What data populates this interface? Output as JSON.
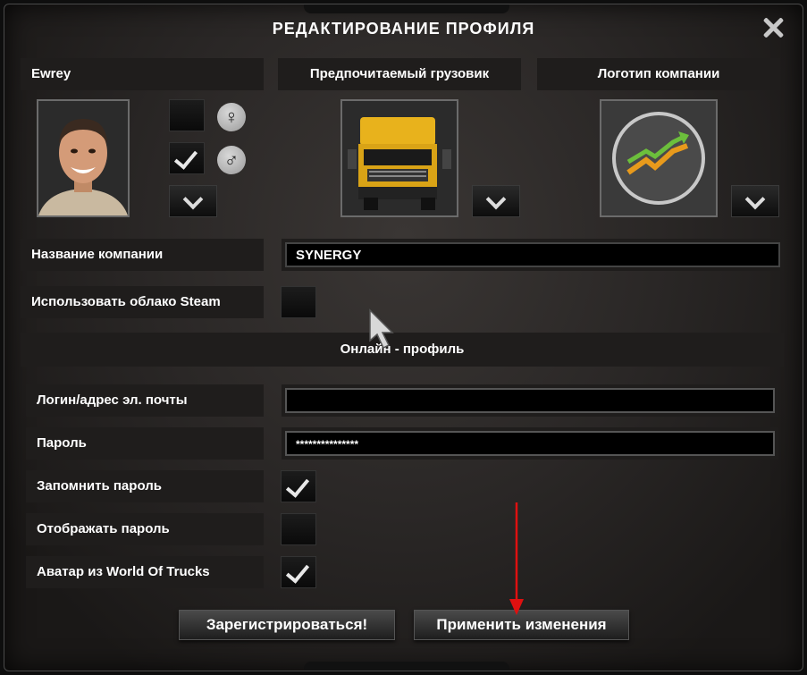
{
  "dialog": {
    "title": "РЕДАКТИРОВАНИЕ ПРОФИЛЯ"
  },
  "profile": {
    "name": "Ewrey",
    "female_checked": false,
    "male_checked": true
  },
  "truck": {
    "header": "Предпочитаемый грузовик"
  },
  "logo": {
    "header": "Логотип компании"
  },
  "company": {
    "label": "Название компании",
    "value": "SYNERGY"
  },
  "steam": {
    "label": "Использовать облако Steam",
    "checked": false
  },
  "online": {
    "header": "Онлайн - профиль",
    "login_label": "Логин/адрес эл. почты",
    "login_value": "",
    "password_label": "Пароль",
    "password_value": "***************",
    "remember_label": "Запомнить пароль",
    "remember_checked": true,
    "show_label": "Отображать пароль",
    "show_checked": false,
    "avatar_label": "Аватар из World Of Trucks",
    "avatar_checked": true
  },
  "buttons": {
    "register": "Зарегистрироваться!",
    "apply": "Применить изменения"
  },
  "colors": {
    "annotation_arrow": "#e01010",
    "accent_truck": "#e8b21c"
  }
}
